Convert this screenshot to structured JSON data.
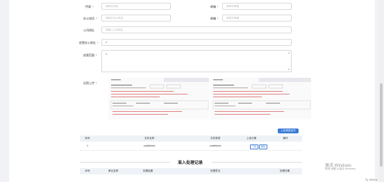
{
  "form": {
    "phone_label": "传真",
    "phone_placeholder": "请填写传真",
    "email_label": "邮箱",
    "email_placeholder": "请填写邮箱",
    "office_phone_label": "办公电话",
    "office_phone_placeholder": "请填写办公电话",
    "zip_label": "邮编",
    "zip_placeholder": "请填写邮编",
    "website_label": "公司网址",
    "website_placeholder": "请输入公司网址",
    "address_label": "经营办公地址",
    "address_value": "1",
    "scope_label": "经营范围",
    "scope_value": "1",
    "cert_label": "证照上传",
    "upload_button": "上传资质证书"
  },
  "files_table": {
    "headers": [
      "序号",
      "文件名称",
      "文件类型",
      "上传日期",
      "操作"
    ],
    "rows": [
      {
        "index": "1",
        "name": "undefined",
        "type": "undefined",
        "date": "",
        "view": "下载",
        "delete": "删除"
      }
    ]
  },
  "history": {
    "title": "准入处理记录",
    "headers": [
      "序号",
      "单位名称",
      "处理结果",
      "处理意见",
      "处理日期"
    ]
  },
  "watermark": {
    "line1": "激活 Windows",
    "line2": "转到\"设置\"以激活 Windows。"
  },
  "zoom": "100%",
  "colors": {
    "accent": "#3a7bd5",
    "required": "#e02020",
    "table_header": "#eef2f7"
  }
}
